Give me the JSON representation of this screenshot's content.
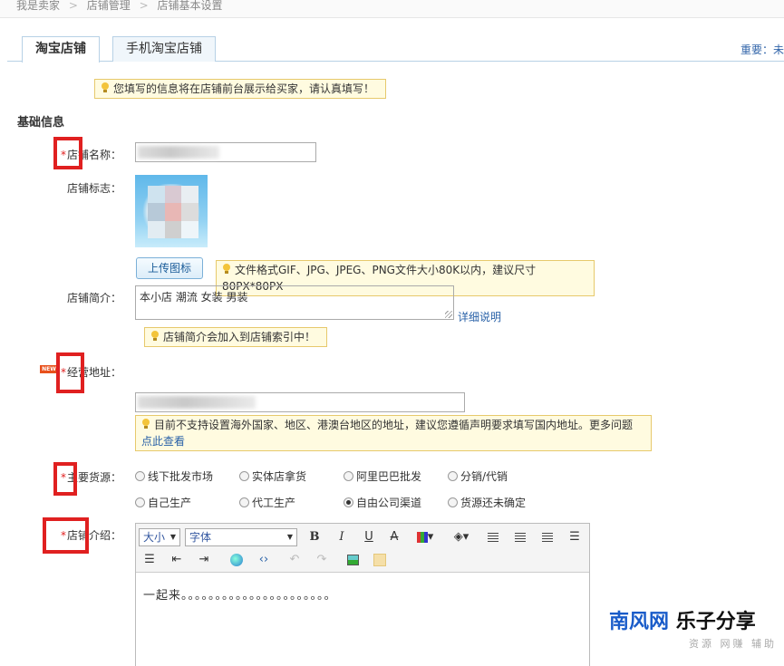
{
  "breadcrumb": {
    "items": [
      "我是卖家",
      "店铺管理",
      "店铺基本设置"
    ],
    "separator": ">"
  },
  "tabs": [
    {
      "label": "淘宝店铺",
      "active": true
    },
    {
      "label": "手机淘宝店铺",
      "active": false
    }
  ],
  "important_text": "重要：未",
  "top_notice": "您填写的信息将在店铺前台展示给买家，请认真填写！",
  "section_title": "基础信息",
  "fields": {
    "shop_name": {
      "required_mark": "*",
      "label": "店铺名称："
    },
    "shop_logo": {
      "label": "店铺标志：",
      "upload_button": "上传图标",
      "notice": "文件格式GIF、JPG、JPEG、PNG文件大小80K以内，建议尺寸80PX*80PX"
    },
    "shop_intro": {
      "label": "店铺简介：",
      "value": "本小店 潮流 女装  男装",
      "help_link": "详细说明",
      "notice": "店铺简介会加入到店铺索引中！"
    },
    "address": {
      "required_mark": "*",
      "badge": "NEW",
      "label": "经营地址：",
      "notice_line1": "目前不支持设置海外国家、地区、港澳台地区的地址，建议您遵循声明要求填写国内地址。更多问题",
      "notice_line2": "点此查看"
    },
    "supply_source": {
      "required_mark": "*",
      "label": "主要货源：",
      "options": [
        {
          "label": "线下批发市场",
          "checked": false
        },
        {
          "label": "实体店拿货",
          "checked": false
        },
        {
          "label": "阿里巴巴批发",
          "checked": false
        },
        {
          "label": "分销/代销",
          "checked": false
        },
        {
          "label": "自己生产",
          "checked": false
        },
        {
          "label": "代工生产",
          "checked": false
        },
        {
          "label": "自由公司渠道",
          "checked": true
        },
        {
          "label": "货源还未确定",
          "checked": false
        }
      ]
    },
    "shop_description": {
      "required_mark": "*",
      "label": "店铺介绍：",
      "editor": {
        "size_select": "大小",
        "font_select": "字体",
        "content": "一起来。。。。。。。。。。。。。。。。。。。。。。"
      }
    }
  },
  "toolbar_icons": [
    "bold-icon",
    "italic-icon",
    "underline-icon",
    "strikethrough-icon",
    "color-grid-icon",
    "fill-color-icon",
    "align-left-icon",
    "align-center-icon",
    "align-right-icon",
    "unordered-list-icon",
    "ordered-list-icon",
    "outdent-icon",
    "indent-icon",
    "link-icon",
    "source-code-icon",
    "undo-icon",
    "redo-icon",
    "image-icon",
    "edit-icon"
  ],
  "watermark": {
    "blue": "南风网",
    "black": "乐子分享",
    "sub": "资源 网赚 辅助"
  },
  "colors": {
    "required": "#e02020",
    "link": "#2a62a8",
    "notice_bg": "#fffbe0",
    "notice_border": "#e7c96c",
    "tab_border": "#b7d1e6",
    "marker": "#e02020"
  }
}
